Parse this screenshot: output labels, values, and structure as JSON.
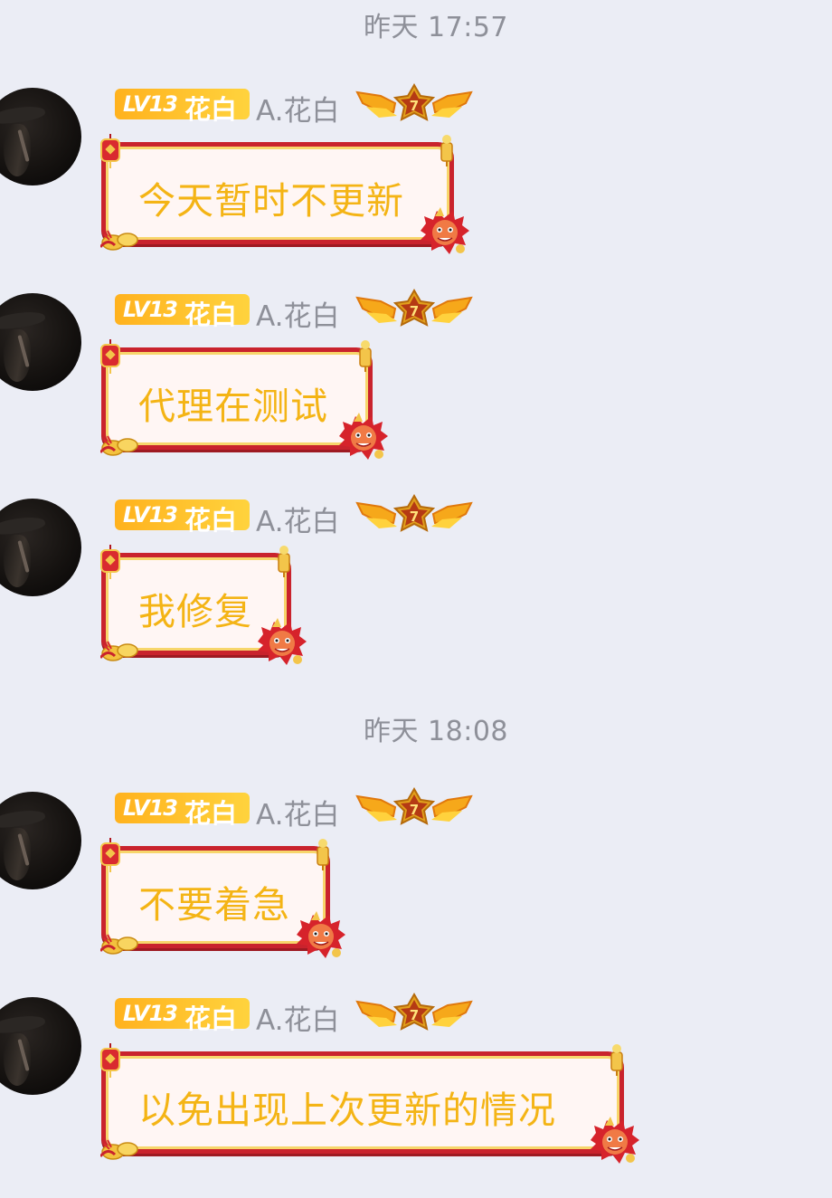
{
  "timestamps": [
    "昨天 17:57",
    "昨天 18:08"
  ],
  "sender": {
    "level": "LV13",
    "level_title": "花白",
    "nickname": "A.花白",
    "honor_badge_number": "7"
  },
  "messages": [
    {
      "text": "今天暂时不更新"
    },
    {
      "text": "代理在测试"
    },
    {
      "text": "我修复"
    },
    {
      "text": "不要着急"
    },
    {
      "text": "以免出现上次更新的情况"
    }
  ],
  "colors": {
    "background": "#ebedf5",
    "bubble_text": "#f4b415",
    "bubble_border": "#c9232d",
    "level_badge": "#ffc02b",
    "meta_text": "#8e9099"
  },
  "icons": {
    "avatar": "user-avatar",
    "crown": "winged-crown-badge-icon",
    "bubble_decor": [
      "lantern-icon",
      "firework-icon",
      "coins-icon",
      "lion-dance-icon"
    ]
  }
}
